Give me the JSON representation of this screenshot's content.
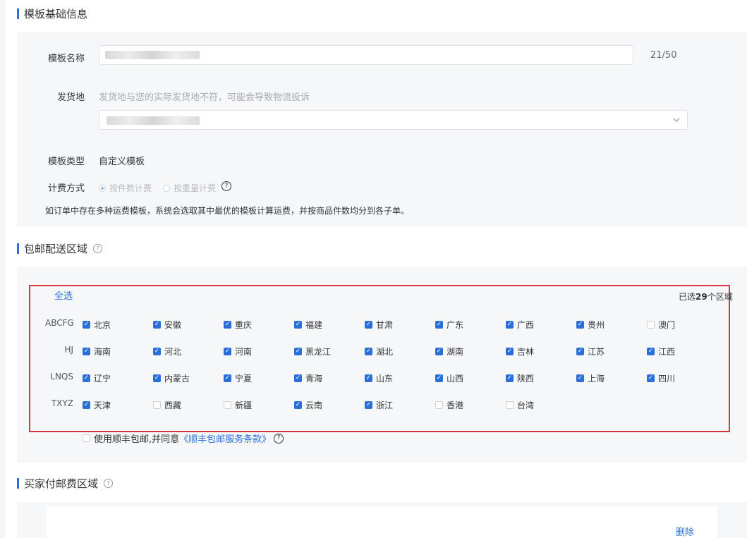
{
  "section1": {
    "title": "模板基础信息",
    "name_label": "模板名称",
    "name_counter": "21/50",
    "origin_label": "发货地",
    "origin_hint": "发货地与您的实际发货地不符，可能会导致物流投诉",
    "type_label": "模板类型",
    "type_value": "自定义模板",
    "billing_label": "计费方式",
    "billing_option1": "按件数计费",
    "billing_option2": "按重量计费",
    "billing_help": "?",
    "note": "如订单中存在多种运费模板，系统会选取其中最优的模板计算运费，并按商品件数均分到各子单。"
  },
  "section2": {
    "title": "包邮配送区域",
    "help": "?",
    "select_all": "全选",
    "selected_prefix": "已选",
    "selected_count": "29",
    "selected_suffix": "个区域",
    "groups": [
      {
        "label": "ABCFG",
        "regions": [
          {
            "name": "北京",
            "checked": true
          },
          {
            "name": "安徽",
            "checked": true
          },
          {
            "name": "重庆",
            "checked": true
          },
          {
            "name": "福建",
            "checked": true
          },
          {
            "name": "甘肃",
            "checked": true
          },
          {
            "name": "广东",
            "checked": true
          },
          {
            "name": "广西",
            "checked": true
          },
          {
            "name": "贵州",
            "checked": true
          },
          {
            "name": "澳门",
            "checked": false
          }
        ]
      },
      {
        "label": "HJ",
        "regions": [
          {
            "name": "海南",
            "checked": true
          },
          {
            "name": "河北",
            "checked": true
          },
          {
            "name": "河南",
            "checked": true
          },
          {
            "name": "黑龙江",
            "checked": true
          },
          {
            "name": "湖北",
            "checked": true
          },
          {
            "name": "湖南",
            "checked": true
          },
          {
            "name": "吉林",
            "checked": true
          },
          {
            "name": "江苏",
            "checked": true
          },
          {
            "name": "江西",
            "checked": true
          }
        ]
      },
      {
        "label": "LNQS",
        "regions": [
          {
            "name": "辽宁",
            "checked": true
          },
          {
            "name": "内蒙古",
            "checked": true
          },
          {
            "name": "宁夏",
            "checked": true
          },
          {
            "name": "青海",
            "checked": true
          },
          {
            "name": "山东",
            "checked": true
          },
          {
            "name": "山西",
            "checked": true
          },
          {
            "name": "陕西",
            "checked": true
          },
          {
            "name": "上海",
            "checked": true
          },
          {
            "name": "四川",
            "checked": true
          }
        ]
      },
      {
        "label": "TXYZ",
        "regions": [
          {
            "name": "天津",
            "checked": true
          },
          {
            "name": "西藏",
            "checked": false
          },
          {
            "name": "新疆",
            "checked": false
          },
          {
            "name": "云南",
            "checked": true
          },
          {
            "name": "浙江",
            "checked": true
          },
          {
            "name": "香港",
            "checked": false
          },
          {
            "name": "台湾",
            "checked": false
          }
        ]
      }
    ],
    "sf_text": "使用顺丰包邮,并同意",
    "sf_link": "《顺丰包邮服务条款》",
    "sf_help": "?"
  },
  "section3": {
    "title": "买家付邮费区域",
    "help": "?",
    "delete_label": "删除"
  },
  "colors": {
    "accent": "#2a6ed8",
    "highlight_border": "#d9363e",
    "panel_bg": "#f6f7f9"
  },
  "icons": {
    "chevron": "chevron-down-icon",
    "check": "check-icon",
    "help": "question-circle-icon"
  }
}
